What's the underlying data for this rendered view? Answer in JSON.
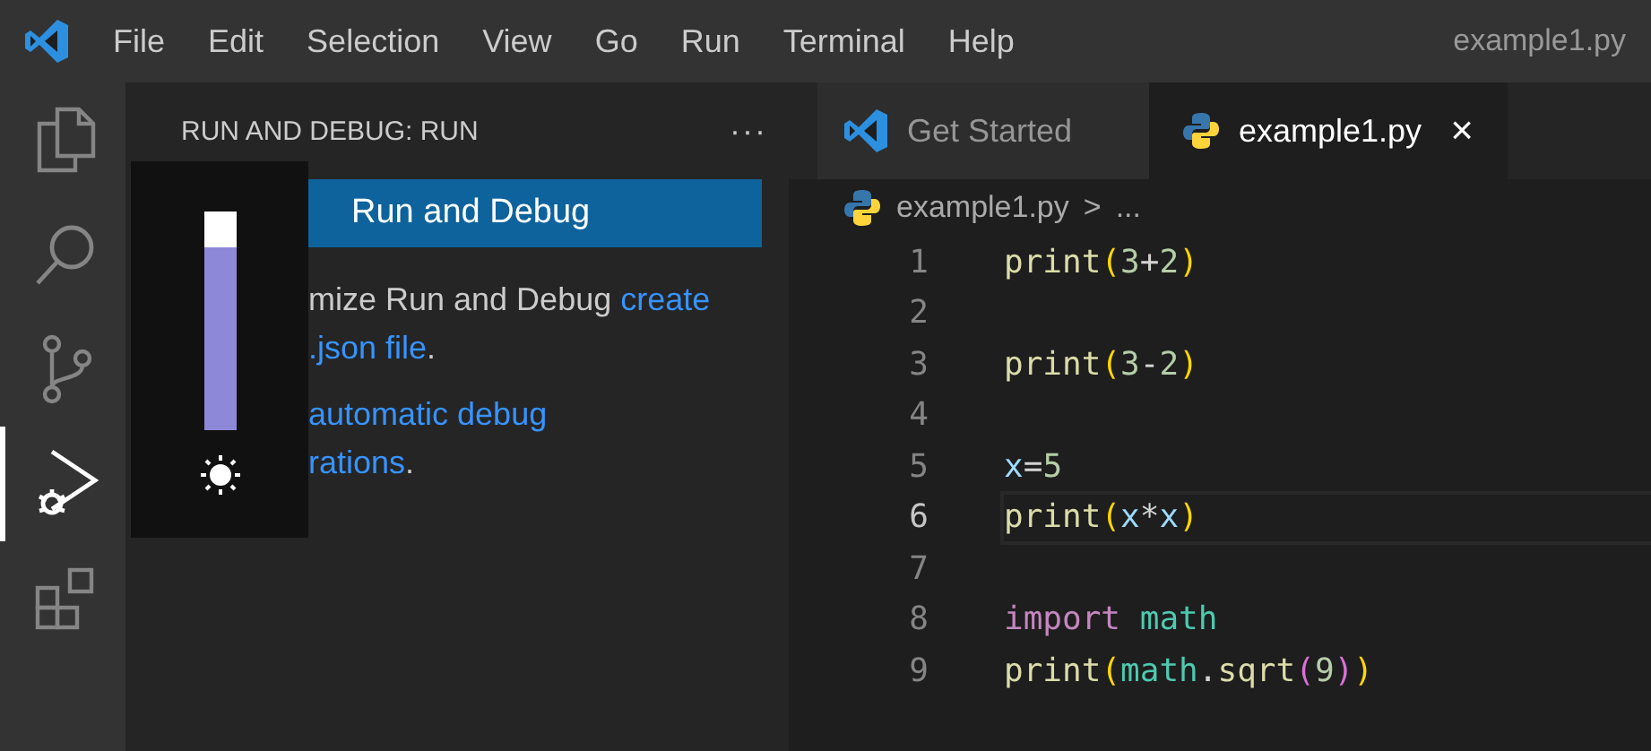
{
  "menu": {
    "items": [
      "File",
      "Edit",
      "Selection",
      "View",
      "Go",
      "Run",
      "Terminal",
      "Help"
    ],
    "title": "example1.py"
  },
  "activity_bar": [
    {
      "kind": "explorer",
      "selected": false
    },
    {
      "kind": "search",
      "selected": false
    },
    {
      "kind": "source-control",
      "selected": false
    },
    {
      "kind": "run",
      "selected": true
    },
    {
      "kind": "extensions",
      "selected": false
    }
  ],
  "sidebar": {
    "title": "RUN AND DEBUG: RUN",
    "more": "···",
    "button": "Run and Debug",
    "paragraphs": [
      {
        "lines": [
          [
            {
              "text": "mize Run and Debug ",
              "kind": "text"
            },
            {
              "text": "create",
              "kind": "link"
            }
          ],
          [
            {
              "text": ".json file",
              "kind": "link"
            },
            {
              "text": ".",
              "kind": "text"
            }
          ]
        ]
      },
      {
        "lines": [
          [
            {
              "text": "automatic debug",
              "kind": "link"
            }
          ],
          [
            {
              "text": "rations",
              "kind": "link"
            },
            {
              "text": ".",
              "kind": "text"
            }
          ]
        ]
      }
    ]
  },
  "brightness": {
    "level": 0.84
  },
  "tabs": [
    {
      "label": "Get Started",
      "kind": "welcome",
      "selected": false
    },
    {
      "label": "example1.py",
      "kind": "python",
      "selected": true,
      "close": "×"
    }
  ],
  "breadcrumb": {
    "file": "example1.py",
    "separator": ">",
    "rest": "..."
  },
  "code": [
    {
      "number": "1",
      "current": false,
      "tokens": [
        {
          "text": "print",
          "kind": "fn"
        },
        {
          "text": "(",
          "kind": "bracket"
        },
        {
          "text": "3",
          "kind": "num"
        },
        {
          "text": "+",
          "kind": "op"
        },
        {
          "text": "2",
          "kind": "num"
        },
        {
          "text": ")",
          "kind": "bracket"
        }
      ]
    },
    {
      "number": "2",
      "current": false
    },
    {
      "number": "3",
      "current": false,
      "tokens": [
        {
          "text": "print",
          "kind": "fn"
        },
        {
          "text": "(",
          "kind": "bracket"
        },
        {
          "text": "3",
          "kind": "num"
        },
        {
          "text": "-",
          "kind": "op"
        },
        {
          "text": "2",
          "kind": "num"
        },
        {
          "text": ")",
          "kind": "bracket"
        }
      ]
    },
    {
      "number": "4",
      "current": false
    },
    {
      "number": "5",
      "current": false,
      "tokens": [
        {
          "text": "x",
          "kind": "var"
        },
        {
          "text": "=",
          "kind": "op"
        },
        {
          "text": "5",
          "kind": "num"
        }
      ]
    },
    {
      "number": "6",
      "current": true,
      "tokens": [
        {
          "text": "print",
          "kind": "fn"
        },
        {
          "text": "(",
          "kind": "bracket"
        },
        {
          "text": "x",
          "kind": "var"
        },
        {
          "text": "*",
          "kind": "op"
        },
        {
          "text": "x",
          "kind": "var"
        },
        {
          "text": ")",
          "kind": "bracket"
        }
      ]
    },
    {
      "number": "7",
      "current": false
    },
    {
      "number": "8",
      "current": false,
      "tokens": [
        {
          "text": "import",
          "kind": "kw"
        },
        {
          "text": "math",
          "kind": "mod"
        }
      ]
    },
    {
      "number": "9",
      "current": false,
      "tokens": [
        {
          "text": "print",
          "kind": "fn"
        },
        {
          "text": "(",
          "kind": "bracket"
        },
        {
          "text": "math",
          "kind": "mod"
        },
        {
          "text": ".",
          "kind": "op"
        },
        {
          "text": "sqrt",
          "kind": "fn"
        },
        {
          "text": "(",
          "kind": "bracket2"
        },
        {
          "text": "9",
          "kind": "num"
        },
        {
          "text": ")",
          "kind": "bracket2"
        },
        {
          "text": ")",
          "kind": "bracket"
        }
      ]
    }
  ]
}
